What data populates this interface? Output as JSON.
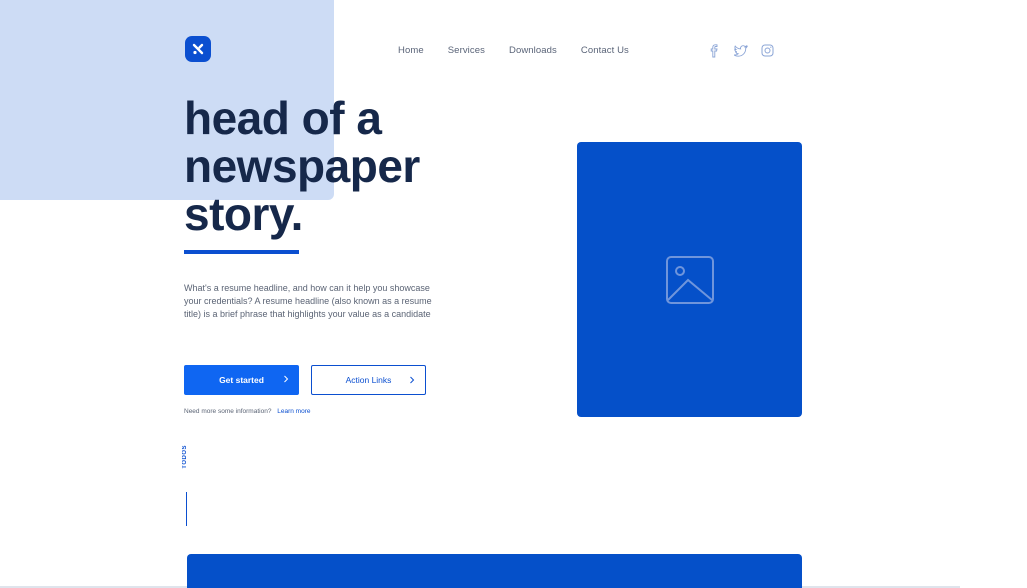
{
  "brand": {
    "logo_icon": "brand-logo-icon",
    "accent_color": "#0b4fd0"
  },
  "nav": {
    "items": [
      {
        "label": "Home"
      },
      {
        "label": "Services"
      },
      {
        "label": "Downloads"
      },
      {
        "label": "Contact Us"
      }
    ]
  },
  "social": {
    "icons": [
      "facebook-icon",
      "twitter-icon",
      "instagram-icon"
    ]
  },
  "hero": {
    "headline_lines": [
      "head of a",
      "newspaper",
      "story."
    ],
    "description": "What's a resume headline, and how can it help you showcase your credentials? A resume headline (also known as a resume title) is a brief phrase that highlights your value as a candidate",
    "primary_button": "Get started",
    "secondary_button": "Action Links",
    "more_text": "Need more some information?",
    "more_link": "Learn more",
    "vertical_label": "TODOS",
    "image_icon": "image-placeholder-icon"
  },
  "colors": {
    "page_bg": "#ffffff",
    "accent_block": "#cddcf5",
    "headline": "#16284a",
    "primary_button": "#0f66f2",
    "image_block": "#0550c9"
  }
}
